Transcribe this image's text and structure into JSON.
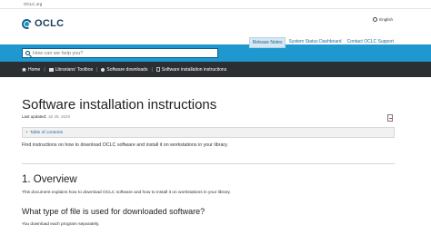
{
  "top_strip": {
    "site": "OCLC.org"
  },
  "header": {
    "logo_text": "OCLC",
    "language": "English",
    "nav": [
      "Release Notes",
      "System Status Dashboard",
      "Contact OCLC Support"
    ]
  },
  "search": {
    "placeholder": "How can we help you?"
  },
  "breadcrumb": [
    "Home",
    "Librarians' Toolbox",
    "Software downloads",
    "Software installation instructions"
  ],
  "article": {
    "title": "Software installation instructions",
    "updated_label": "Last updated:",
    "updated_date": "Jul 28, 2020",
    "toc_label": "Table of contents",
    "intro": "Find instructions on how to download OCLC software and install it on workstations in your library.",
    "section1_title": "1. Overview",
    "section1_text": "This document explains how to download OCLC software and how to install it on workstations in your library.",
    "section2_title": "What type of file is used for downloaded software?",
    "section2_text": "You download each program separately."
  },
  "colors": {
    "search_band": "#1f98cf",
    "breadcrumb_bar": "#2b2e33",
    "link": "#1d6c9c"
  }
}
